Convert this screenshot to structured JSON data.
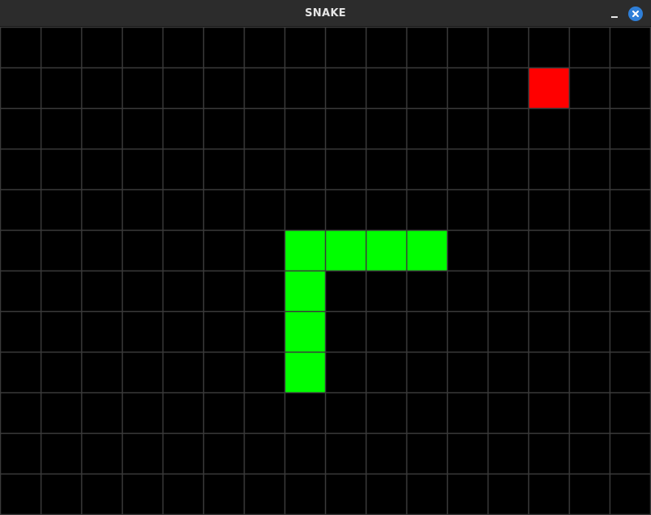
{
  "window": {
    "title": "SNAKE",
    "minimize_icon": "minimize-icon",
    "close_icon": "close-icon"
  },
  "game": {
    "grid": {
      "columns": 16,
      "rows": 12
    },
    "snake": [
      [
        7,
        5
      ],
      [
        8,
        5
      ],
      [
        9,
        5
      ],
      [
        10,
        5
      ],
      [
        7,
        6
      ],
      [
        7,
        7
      ],
      [
        7,
        8
      ]
    ],
    "food": [
      13,
      1
    ],
    "colors": {
      "background": "#000000",
      "grid_line": "#3a3a3a",
      "snake": "#00ff00",
      "food": "#ff0000",
      "titlebar": "#2c2c2c",
      "close_button": "#2f7fd8"
    }
  }
}
